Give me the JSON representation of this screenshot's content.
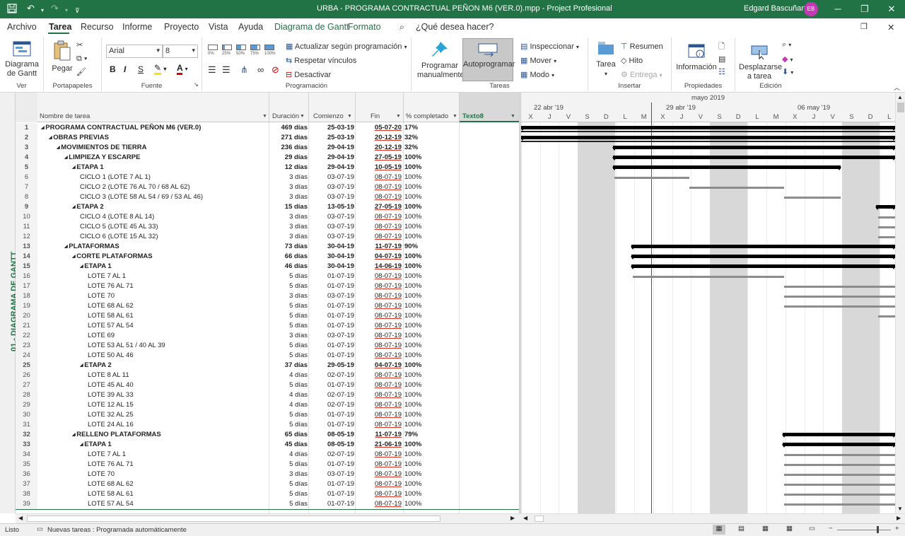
{
  "titlebar": {
    "doc_title": "URBA - PROGRAMA CONTRACTUAL PEÑON M6 (VER.0).mpp  -  Project Profesional",
    "user": "Edgard Bascuñan",
    "avatar": "EB"
  },
  "menubar": {
    "items": [
      "Archivo",
      "Tarea",
      "Recurso",
      "Informe",
      "Proyecto",
      "Vista",
      "Ayuda"
    ],
    "contextual": [
      "Diagrama de Gantt",
      "Formato"
    ],
    "search_placeholder": "¿Qué desea hacer?"
  },
  "ribbon": {
    "ver": {
      "label": "Ver",
      "gantt_btn": "Diagrama de Gantt"
    },
    "portapapeles": {
      "label": "Portapapeles",
      "paste": "Pegar"
    },
    "fuente": {
      "label": "Fuente",
      "font": "Arial",
      "size": "8"
    },
    "programacion": {
      "label": "Programación",
      "actualizar": "Actualizar según programación",
      "respetar": "Respetar vínculos",
      "desactivar": "Desactivar",
      "pcts": [
        "0%",
        "25%",
        "50%",
        "75%",
        "100%"
      ]
    },
    "tareas": {
      "label": "Tareas",
      "manual": "Programar manualmente",
      "auto": "Autoprogramar",
      "inspeccionar": "Inspeccionar",
      "mover": "Mover",
      "modo": "Modo"
    },
    "insertar": {
      "label": "Insertar",
      "tarea": "Tarea",
      "resumen": "Resumen",
      "hito": "Hito",
      "entrega": "Entrega"
    },
    "propiedades": {
      "label": "Propiedades",
      "info": "Información"
    },
    "edicion": {
      "label": "Edición",
      "desplazarse": "Desplazarse a tarea"
    }
  },
  "sidebar": {
    "view_label": "01.- DIAGRAMA DE GANTT"
  },
  "table": {
    "headers": {
      "name": "Nombre de tarea",
      "duration": "Duración",
      "start": "Comienzo",
      "finish": "Fin",
      "pct": "% completado",
      "text8": "Texto8"
    },
    "rows": [
      {
        "id": "1",
        "name": "PROGRAMA CONTRACTUAL PEÑON M6 (VER.0)",
        "dur": "469 días",
        "start": "25-03-19",
        "fin": "05-07-20",
        "pct": "17%",
        "level": 0,
        "sum": true
      },
      {
        "id": "2",
        "name": "OBRAS PREVIAS",
        "dur": "271 días",
        "start": "25-03-19",
        "fin": "20-12-19",
        "pct": "32%",
        "level": 1,
        "sum": true
      },
      {
        "id": "3",
        "name": "MOVIMIENTOS DE TIERRA",
        "dur": "236 días",
        "start": "29-04-19",
        "fin": "20-12-19",
        "pct": "32%",
        "level": 2,
        "sum": true
      },
      {
        "id": "4",
        "name": "LIMPIEZA Y ESCARPE",
        "dur": "29 días",
        "start": "29-04-19",
        "fin": "27-05-19",
        "pct": "100%",
        "level": 3,
        "sum": true
      },
      {
        "id": "5",
        "name": "ETAPA 1",
        "dur": "12 días",
        "start": "29-04-19",
        "fin": "10-05-19",
        "pct": "100%",
        "level": 4,
        "sum": true
      },
      {
        "id": "6",
        "name": "CICLO 1 (LOTE 7 AL 1)",
        "dur": "3 días",
        "start": "03-07-19",
        "fin": "08-07-19",
        "pct": "100%",
        "level": 5,
        "sum": false
      },
      {
        "id": "7",
        "name": "CICLO 2 (LOTE 76 AL 70 / 68 AL 62)",
        "dur": "3 días",
        "start": "03-07-19",
        "fin": "08-07-19",
        "pct": "100%",
        "level": 5,
        "sum": false
      },
      {
        "id": "8",
        "name": "CICLO 3 (LOTE 58 AL 54 / 69 / 53 AL 46)",
        "dur": "3 días",
        "start": "03-07-19",
        "fin": "08-07-19",
        "pct": "100%",
        "level": 5,
        "sum": false
      },
      {
        "id": "9",
        "name": "ETAPA 2",
        "dur": "15 días",
        "start": "13-05-19",
        "fin": "27-05-19",
        "pct": "100%",
        "level": 4,
        "sum": true
      },
      {
        "id": "10",
        "name": "CICLO 4 (LOTE 8 AL 14)",
        "dur": "3 días",
        "start": "03-07-19",
        "fin": "08-07-19",
        "pct": "100%",
        "level": 5,
        "sum": false
      },
      {
        "id": "11",
        "name": "CICLO 5 (LOTE 45 AL 33)",
        "dur": "3 días",
        "start": "03-07-19",
        "fin": "08-07-19",
        "pct": "100%",
        "level": 5,
        "sum": false
      },
      {
        "id": "12",
        "name": "CICLO 6 (LOTE 15 AL 32)",
        "dur": "3 días",
        "start": "03-07-19",
        "fin": "08-07-19",
        "pct": "100%",
        "level": 5,
        "sum": false
      },
      {
        "id": "13",
        "name": "PLATAFORMAS",
        "dur": "73 días",
        "start": "30-04-19",
        "fin": "11-07-19",
        "pct": "90%",
        "level": 3,
        "sum": true
      },
      {
        "id": "14",
        "name": "CORTE PLATAFORMAS",
        "dur": "66 días",
        "start": "30-04-19",
        "fin": "04-07-19",
        "pct": "100%",
        "level": 4,
        "sum": true
      },
      {
        "id": "15",
        "name": "ETAPA 1",
        "dur": "46 días",
        "start": "30-04-19",
        "fin": "14-06-19",
        "pct": "100%",
        "level": 5,
        "sum": true
      },
      {
        "id": "16",
        "name": "LOTE 7 AL 1",
        "dur": "5 días",
        "start": "01-07-19",
        "fin": "08-07-19",
        "pct": "100%",
        "level": 6,
        "sum": false
      },
      {
        "id": "17",
        "name": "LOTE 76 AL 71",
        "dur": "5 días",
        "start": "01-07-19",
        "fin": "08-07-19",
        "pct": "100%",
        "level": 6,
        "sum": false
      },
      {
        "id": "18",
        "name": "LOTE 70",
        "dur": "3 días",
        "start": "03-07-19",
        "fin": "08-07-19",
        "pct": "100%",
        "level": 6,
        "sum": false
      },
      {
        "id": "19",
        "name": "LOTE 68 AL 62",
        "dur": "5 días",
        "start": "01-07-19",
        "fin": "08-07-19",
        "pct": "100%",
        "level": 6,
        "sum": false
      },
      {
        "id": "20",
        "name": "LOTE 58 AL 61",
        "dur": "5 días",
        "start": "01-07-19",
        "fin": "08-07-19",
        "pct": "100%",
        "level": 6,
        "sum": false
      },
      {
        "id": "21",
        "name": "LOTE 57 AL 54",
        "dur": "5 días",
        "start": "01-07-19",
        "fin": "08-07-19",
        "pct": "100%",
        "level": 6,
        "sum": false
      },
      {
        "id": "22",
        "name": "LOTE 69",
        "dur": "3 días",
        "start": "03-07-19",
        "fin": "08-07-19",
        "pct": "100%",
        "level": 6,
        "sum": false
      },
      {
        "id": "23",
        "name": "LOTE 53 AL 51 / 40 AL 39",
        "dur": "5 días",
        "start": "01-07-19",
        "fin": "08-07-19",
        "pct": "100%",
        "level": 6,
        "sum": false
      },
      {
        "id": "24",
        "name": "LOTE 50 AL 46",
        "dur": "5 días",
        "start": "01-07-19",
        "fin": "08-07-19",
        "pct": "100%",
        "level": 6,
        "sum": false
      },
      {
        "id": "25",
        "name": "ETAPA 2",
        "dur": "37 días",
        "start": "29-05-19",
        "fin": "04-07-19",
        "pct": "100%",
        "level": 5,
        "sum": true
      },
      {
        "id": "26",
        "name": "LOTE 8 AL 11",
        "dur": "4 días",
        "start": "02-07-19",
        "fin": "08-07-19",
        "pct": "100%",
        "level": 6,
        "sum": false
      },
      {
        "id": "27",
        "name": "LOTE 45 AL 40",
        "dur": "5 días",
        "start": "01-07-19",
        "fin": "08-07-19",
        "pct": "100%",
        "level": 6,
        "sum": false
      },
      {
        "id": "28",
        "name": "LOTE 39 AL 33",
        "dur": "4 días",
        "start": "02-07-19",
        "fin": "08-07-19",
        "pct": "100%",
        "level": 6,
        "sum": false
      },
      {
        "id": "29",
        "name": "LOTE 12 AL 15",
        "dur": "4 días",
        "start": "02-07-19",
        "fin": "08-07-19",
        "pct": "100%",
        "level": 6,
        "sum": false
      },
      {
        "id": "30",
        "name": "LOTE 32 AL 25",
        "dur": "5 días",
        "start": "01-07-19",
        "fin": "08-07-19",
        "pct": "100%",
        "level": 6,
        "sum": false
      },
      {
        "id": "31",
        "name": "LOTE 24 AL 16",
        "dur": "5 días",
        "start": "01-07-19",
        "fin": "08-07-19",
        "pct": "100%",
        "level": 6,
        "sum": false
      },
      {
        "id": "32",
        "name": "RELLENO PLATAFORMAS",
        "dur": "65 días",
        "start": "08-05-19",
        "fin": "11-07-19",
        "pct": "79%",
        "level": 4,
        "sum": true
      },
      {
        "id": "33",
        "name": "ETAPA 1",
        "dur": "45 días",
        "start": "08-05-19",
        "fin": "21-06-19",
        "pct": "100%",
        "level": 5,
        "sum": true
      },
      {
        "id": "34",
        "name": "LOTE 7 AL 1",
        "dur": "4 días",
        "start": "02-07-19",
        "fin": "08-07-19",
        "pct": "100%",
        "level": 6,
        "sum": false
      },
      {
        "id": "35",
        "name": "LOTE 76 AL 71",
        "dur": "5 días",
        "start": "01-07-19",
        "fin": "08-07-19",
        "pct": "100%",
        "level": 6,
        "sum": false
      },
      {
        "id": "36",
        "name": "LOTE 70",
        "dur": "3 días",
        "start": "03-07-19",
        "fin": "08-07-19",
        "pct": "100%",
        "level": 6,
        "sum": false
      },
      {
        "id": "37",
        "name": "LOTE 68 AL 62",
        "dur": "5 días",
        "start": "01-07-19",
        "fin": "08-07-19",
        "pct": "100%",
        "level": 6,
        "sum": false
      },
      {
        "id": "38",
        "name": "LOTE 58 AL 61",
        "dur": "5 días",
        "start": "01-07-19",
        "fin": "08-07-19",
        "pct": "100%",
        "level": 6,
        "sum": false
      },
      {
        "id": "39",
        "name": "LOTE 57 AL 54",
        "dur": "5 días",
        "start": "01-07-19",
        "fin": "08-07-19",
        "pct": "100%",
        "level": 6,
        "sum": false
      }
    ]
  },
  "gantt": {
    "month": "mayo 2019",
    "weeks": [
      "22 abr '19",
      "29 abr '19",
      "06 may '19"
    ],
    "days": [
      "X",
      "J",
      "V",
      "S",
      "D",
      "L",
      "M",
      "X",
      "J",
      "V",
      "S",
      "D",
      "L",
      "M",
      "X",
      "J",
      "V",
      "S",
      "D",
      "L"
    ]
  },
  "status": {
    "ready": "Listo",
    "new_tasks": "Nuevas tareas : Programada automáticamente"
  }
}
